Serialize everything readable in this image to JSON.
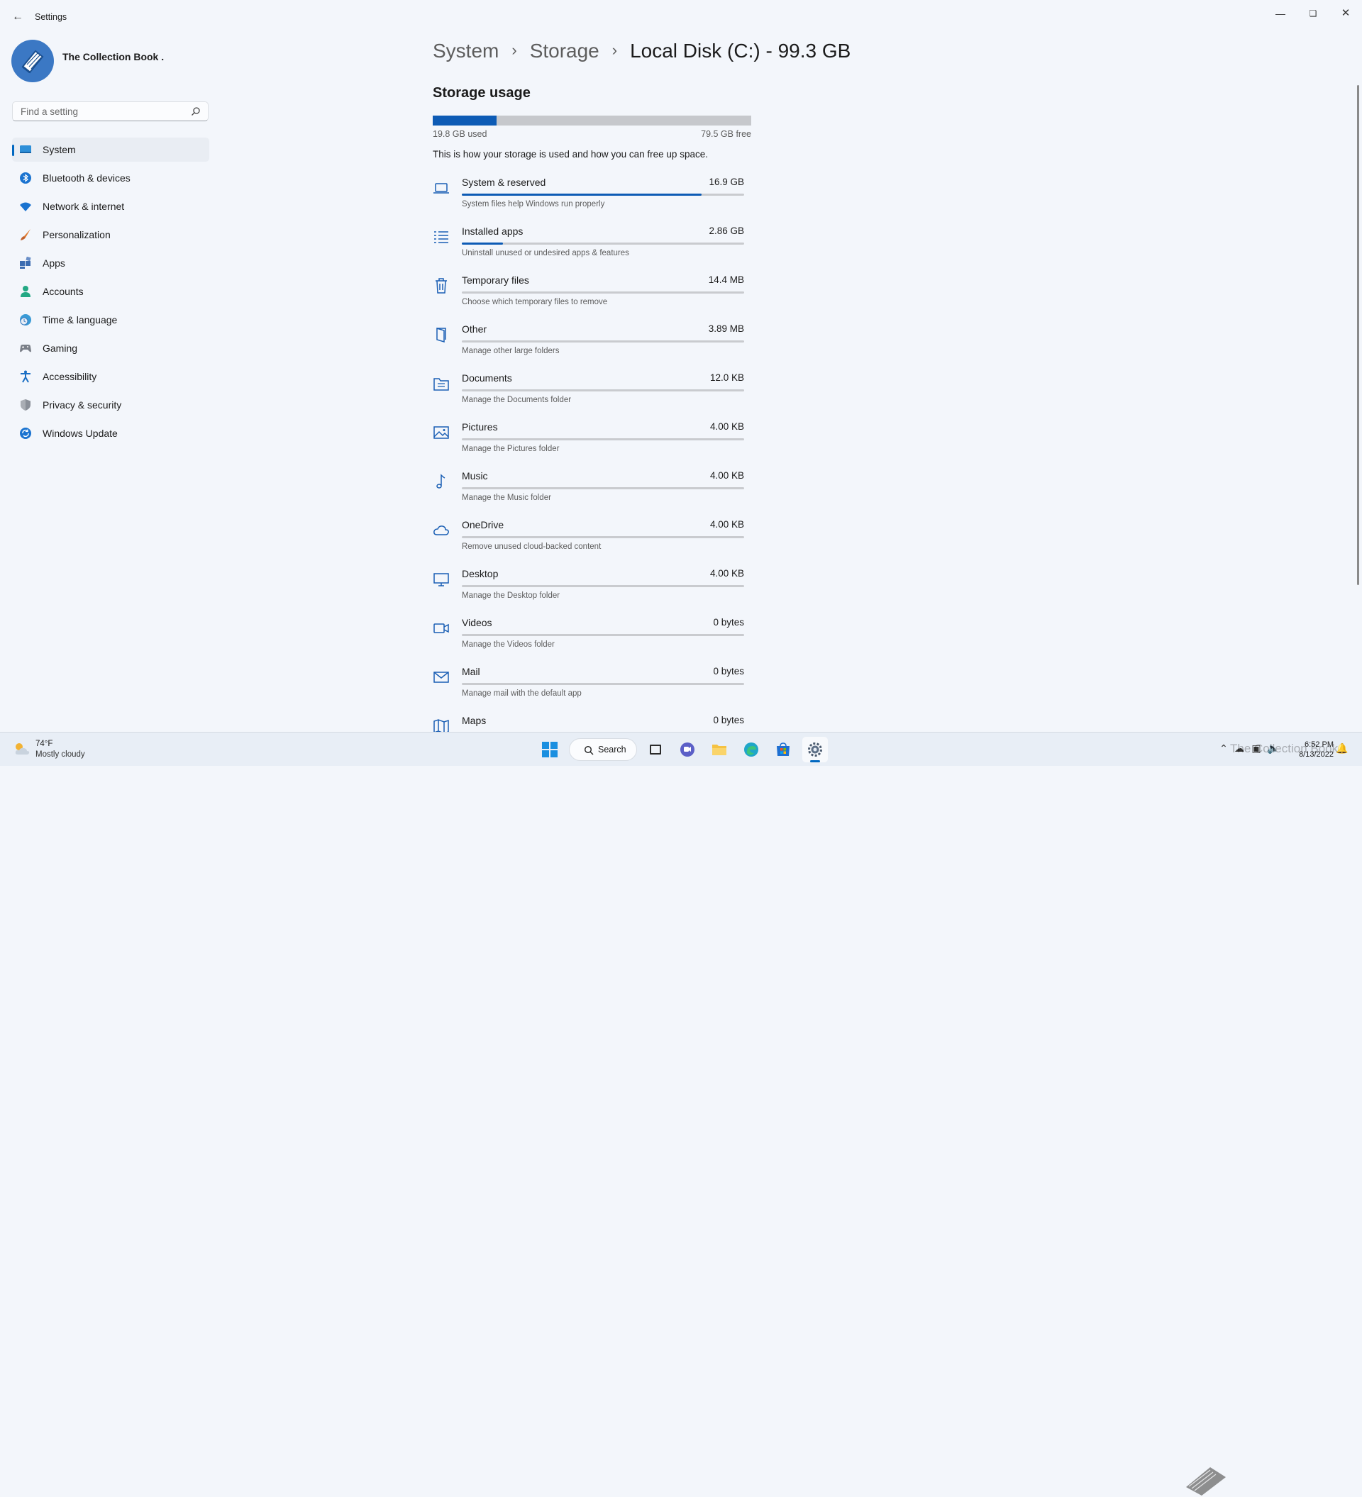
{
  "window": {
    "title": "Settings"
  },
  "profile": {
    "name": "The Collection Book ."
  },
  "search": {
    "placeholder": "Find a setting"
  },
  "sidebar": {
    "items": [
      {
        "label": "System",
        "icon": "system-icon"
      },
      {
        "label": "Bluetooth & devices",
        "icon": "bluetooth-icon"
      },
      {
        "label": "Network & internet",
        "icon": "wifi-icon"
      },
      {
        "label": "Personalization",
        "icon": "brush-icon"
      },
      {
        "label": "Apps",
        "icon": "apps-icon"
      },
      {
        "label": "Accounts",
        "icon": "person-icon"
      },
      {
        "label": "Time & language",
        "icon": "globe-clock-icon"
      },
      {
        "label": "Gaming",
        "icon": "gamepad-icon"
      },
      {
        "label": "Accessibility",
        "icon": "accessibility-icon"
      },
      {
        "label": "Privacy & security",
        "icon": "shield-icon"
      },
      {
        "label": "Windows Update",
        "icon": "update-icon"
      }
    ]
  },
  "breadcrumb": {
    "items": [
      "System",
      "Storage"
    ],
    "current": "Local Disk (C:) - 99.3 GB"
  },
  "storage": {
    "title": "Storage usage",
    "used_label": "19.8 GB used",
    "free_label": "79.5 GB free",
    "used_fraction": 0.2,
    "description": "This is how your storage is used and how you can free up space.",
    "categories": [
      {
        "name": "System & reserved",
        "size": "16.9 GB",
        "desc": "System files help Windows run properly",
        "fraction": 0.85,
        "icon": "laptop-icon"
      },
      {
        "name": "Installed apps",
        "size": "2.86 GB",
        "desc": "Uninstall unused or undesired apps & features",
        "fraction": 0.145,
        "icon": "list-icon"
      },
      {
        "name": "Temporary files",
        "size": "14.4 MB",
        "desc": "Choose which temporary files to remove",
        "fraction": 0,
        "icon": "trash-icon"
      },
      {
        "name": "Other",
        "size": "3.89 MB",
        "desc": "Manage other large folders",
        "fraction": 0,
        "icon": "book-icon"
      },
      {
        "name": "Documents",
        "size": "12.0 KB",
        "desc": "Manage the Documents folder",
        "fraction": 0,
        "icon": "folder-document-icon"
      },
      {
        "name": "Pictures",
        "size": "4.00 KB",
        "desc": "Manage the Pictures folder",
        "fraction": 0,
        "icon": "image-icon"
      },
      {
        "name": "Music",
        "size": "4.00 KB",
        "desc": "Manage the Music folder",
        "fraction": 0,
        "icon": "music-note-icon"
      },
      {
        "name": "OneDrive",
        "size": "4.00 KB",
        "desc": "Remove unused cloud-backed content",
        "fraction": 0,
        "icon": "cloud-icon"
      },
      {
        "name": "Desktop",
        "size": "4.00 KB",
        "desc": "Manage the Desktop folder",
        "fraction": 0,
        "icon": "monitor-icon"
      },
      {
        "name": "Videos",
        "size": "0 bytes",
        "desc": "Manage the Videos folder",
        "fraction": 0,
        "icon": "video-icon"
      },
      {
        "name": "Mail",
        "size": "0 bytes",
        "desc": "Manage mail with the default app",
        "fraction": 0,
        "icon": "mail-icon"
      },
      {
        "name": "Maps",
        "size": "0 bytes",
        "desc": "",
        "fraction": 0,
        "icon": "map-icon"
      }
    ]
  },
  "taskbar": {
    "weather": {
      "temp": "74°F",
      "condition": "Mostly cloudy"
    },
    "search_label": "Search",
    "clock": {
      "time": "6:52 PM",
      "date": "8/13/2022"
    },
    "watermark": "The Collection Book"
  },
  "colors": {
    "accent": "#0067c0",
    "bar_fill": "#0d5bb5",
    "background": "#f3f6fb"
  }
}
